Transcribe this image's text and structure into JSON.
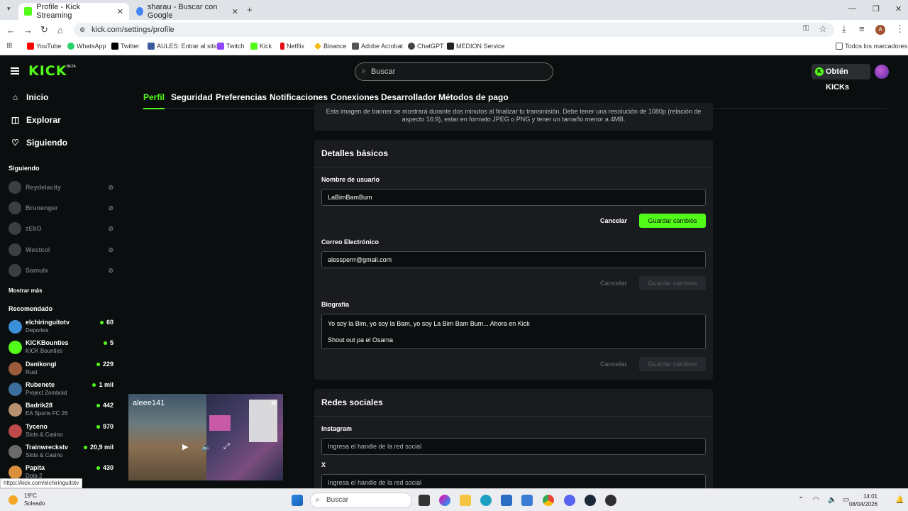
{
  "browser": {
    "tabs": [
      {
        "title": "Profile - Kick Streaming",
        "active": true,
        "favicon_color": "#53fc18"
      },
      {
        "title": "sharau - Buscar con Google",
        "active": false,
        "favicon_color": "#4285f4"
      }
    ],
    "url": "kick.com/settings/profile",
    "bookmarks": [
      {
        "label": "YouTube",
        "color": "#ff0000"
      },
      {
        "label": "WhatsApp",
        "color": "#25d366"
      },
      {
        "label": "Twitter",
        "color": "#000000"
      },
      {
        "label": "AULES: Entrar al sitio",
        "color": "#3a5a9c"
      },
      {
        "label": "Twitch",
        "color": "#9146ff"
      },
      {
        "label": "Kick",
        "color": "#53fc18"
      },
      {
        "label": "Netflix",
        "color": "#e50914"
      },
      {
        "label": "Binance",
        "color": "#f0b90b"
      },
      {
        "label": "Adobe Acrobat",
        "color": "#555555"
      },
      {
        "label": "ChatGPT",
        "color": "#444444"
      },
      {
        "label": "MEDION Service",
        "color": "#222222"
      }
    ],
    "all_bookmarks_label": "Todos los marcadores",
    "status_url": "https://kick.com/elchiringuitotv"
  },
  "kick": {
    "logo": "KICK",
    "beta": "BETA",
    "search_placeholder": "Buscar",
    "get_kicks": "Obtén KICKs",
    "brand_color": "#53fc18",
    "settings_tabs": [
      "Perfil",
      "Seguridad",
      "Preferencias",
      "Notificaciones",
      "Conexiones",
      "Desarrollador",
      "Métodos de pago"
    ],
    "nav": [
      {
        "label": "Inicio",
        "icon": "home-icon"
      },
      {
        "label": "Explorar",
        "icon": "compass-icon"
      },
      {
        "label": "Siguiendo",
        "icon": "heart-icon"
      }
    ],
    "following_title": "Siguiendo",
    "following": [
      {
        "name": "Reydelacity"
      },
      {
        "name": "Brunenger"
      },
      {
        "name": "zEkO"
      },
      {
        "name": "Westcol"
      },
      {
        "name": "Samulx"
      }
    ],
    "show_more": "Mostrar más",
    "recommended_title": "Recomendado",
    "recommended": [
      {
        "name": "elchiringuitotv",
        "category": "Deportes",
        "viewers": "60",
        "avatar_color": "#3b8fd9"
      },
      {
        "name": "KICKBounties",
        "category": "KICK Bounties",
        "viewers": "5",
        "avatar_color": "#53fc18"
      },
      {
        "name": "Danikongi",
        "category": "Rust",
        "viewers": "229",
        "avatar_color": "#9c5b3a"
      },
      {
        "name": "Rubenete",
        "category": "Project Zomboid",
        "viewers": "1 mil",
        "avatar_color": "#3a6e9c"
      },
      {
        "name": "Badrik28",
        "category": "EA Sports FC 26",
        "viewers": "442",
        "avatar_color": "#b8926e"
      },
      {
        "name": "Tyceno",
        "category": "Slots & Casino",
        "viewers": "970",
        "avatar_color": "#c04a4a"
      },
      {
        "name": "Trainwreckstv",
        "category": "Slots & Casino",
        "viewers": "20,9 mil",
        "avatar_color": "#6a6a6a"
      },
      {
        "name": "Papita",
        "category": "Dota 2",
        "viewers": "430",
        "avatar_color": "#d98f3b"
      }
    ],
    "banner_note": "Esta imagen de banner se mostrará durante dos minutos al finalizar tu transmisión. Debe tener una resolución de 1080p (relación de aspecto 16:9), estar en formato JPEG o PNG y tener un tamaño menor a 4MB.",
    "basic": {
      "title": "Detalles básicos",
      "username_label": "Nombre de usuario",
      "username_value": "LaBimBamBum",
      "email_label": "Correo Electrónico",
      "email_value": "alessperrr@gmail.com",
      "bio_label": "Biografía",
      "bio_line1": "Yo soy la Bim, yo soy la Bam, yo soy La Bim Bam Bum... Ahora en Kick",
      "bio_line2": "Shout out pa el Osama",
      "cancel": "Cancelar",
      "save": "Guardar cambios"
    },
    "social": {
      "title": "Redes sociales",
      "instagram_label": "Instagram",
      "x_label": "X",
      "placeholder": "Ingresa el handle de la red social"
    },
    "mini_player": {
      "channel": "aleee141"
    }
  },
  "taskbar": {
    "temp": "19°C",
    "weather": "Soleado",
    "search": "Buscar",
    "time": "14:01",
    "date": "08/04/2026"
  }
}
